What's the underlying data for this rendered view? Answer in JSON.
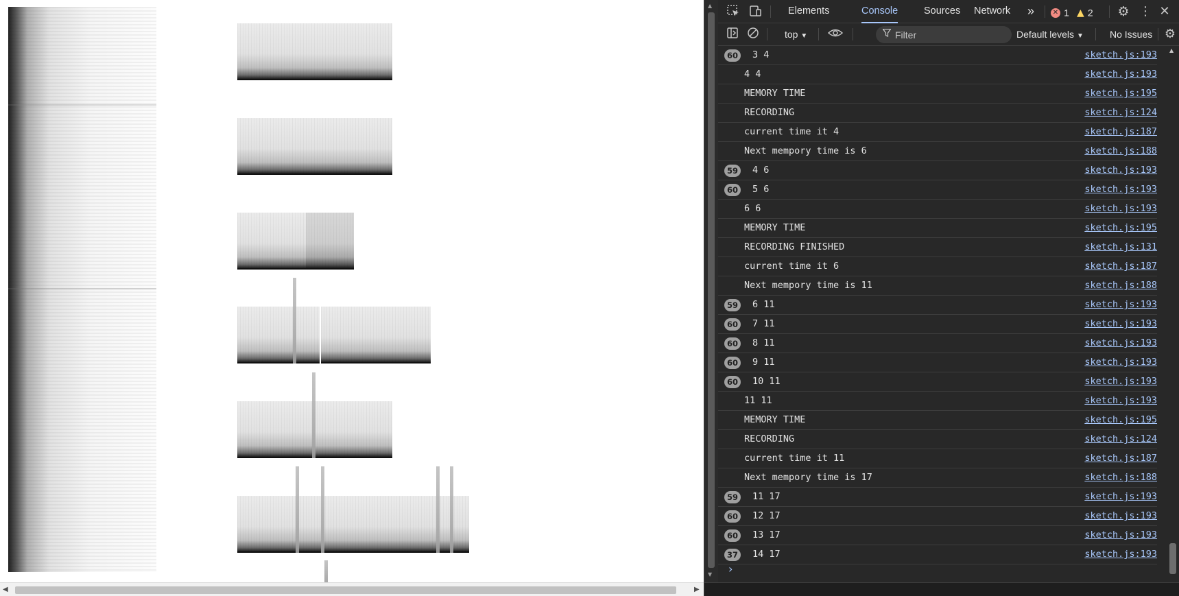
{
  "devtools": {
    "tabs": [
      "Elements",
      "Console",
      "Sources",
      "Network"
    ],
    "active_tab": "Console",
    "more_tabs_glyph": "»",
    "error_count": "1",
    "warning_count": "2",
    "context": "top",
    "filter_placeholder": "Filter",
    "levels": "Default levels",
    "issues": "No Issues",
    "prompt_glyph": "›",
    "colors": {
      "accent": "#a8c7fa",
      "background": "#282828",
      "error": "#f28b82",
      "warning": "#fdd663"
    }
  },
  "console": [
    {
      "count": "60",
      "msg": "3 4",
      "src": "sketch.js:193"
    },
    {
      "count": "",
      "msg": "4 4",
      "src": "sketch.js:193"
    },
    {
      "count": "",
      "msg": "MEMORY TIME",
      "src": "sketch.js:195"
    },
    {
      "count": "",
      "msg": "RECORDING",
      "src": "sketch.js:124"
    },
    {
      "count": "",
      "msg": "current time it 4",
      "src": "sketch.js:187"
    },
    {
      "count": "",
      "msg": "Next mempory time is 6",
      "src": "sketch.js:188"
    },
    {
      "count": "59",
      "msg": "4 6",
      "src": "sketch.js:193"
    },
    {
      "count": "60",
      "msg": "5 6",
      "src": "sketch.js:193"
    },
    {
      "count": "",
      "msg": "6 6",
      "src": "sketch.js:193"
    },
    {
      "count": "",
      "msg": "MEMORY TIME",
      "src": "sketch.js:195"
    },
    {
      "count": "",
      "msg": "RECORDING FINISHED",
      "src": "sketch.js:131"
    },
    {
      "count": "",
      "msg": "current time it 6",
      "src": "sketch.js:187"
    },
    {
      "count": "",
      "msg": "Next mempory time is 11",
      "src": "sketch.js:188"
    },
    {
      "count": "59",
      "msg": "6 11",
      "src": "sketch.js:193"
    },
    {
      "count": "60",
      "msg": "7 11",
      "src": "sketch.js:193"
    },
    {
      "count": "60",
      "msg": "8 11",
      "src": "sketch.js:193"
    },
    {
      "count": "60",
      "msg": "9 11",
      "src": "sketch.js:193"
    },
    {
      "count": "60",
      "msg": "10 11",
      "src": "sketch.js:193"
    },
    {
      "count": "",
      "msg": "11 11",
      "src": "sketch.js:193"
    },
    {
      "count": "",
      "msg": "MEMORY TIME",
      "src": "sketch.js:195"
    },
    {
      "count": "",
      "msg": "RECORDING",
      "src": "sketch.js:124"
    },
    {
      "count": "",
      "msg": "current time it 11",
      "src": "sketch.js:187"
    },
    {
      "count": "",
      "msg": "Next mempory time is 17",
      "src": "sketch.js:188"
    },
    {
      "count": "59",
      "msg": "11 17",
      "src": "sketch.js:193"
    },
    {
      "count": "60",
      "msg": "12 17",
      "src": "sketch.js:193"
    },
    {
      "count": "60",
      "msg": "13 17",
      "src": "sketch.js:193"
    },
    {
      "count": "37",
      "msg": "14 17",
      "src": "sketch.js:193"
    }
  ]
}
